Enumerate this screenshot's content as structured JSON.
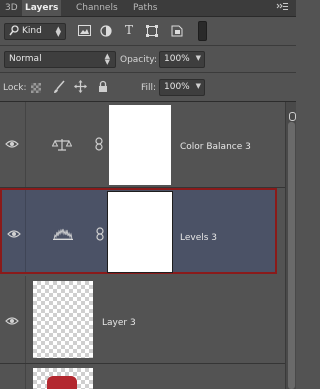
{
  "tabs": [
    {
      "label": "3D"
    },
    {
      "label": "Layers"
    },
    {
      "label": "Channels"
    },
    {
      "label": "Paths"
    }
  ],
  "filter": {
    "kind_label": "Kind"
  },
  "blend": {
    "mode": "Normal",
    "opacity_label": "Opacity:",
    "opacity_value": "100%"
  },
  "lock": {
    "label": "Lock:",
    "fill_label": "Fill:",
    "fill_value": "100%"
  },
  "layers": [
    {
      "name": "Color Balance 3",
      "icon": "scales-icon",
      "selected": false
    },
    {
      "name": "Levels 3",
      "icon": "levels-histogram-icon",
      "selected": true
    },
    {
      "name": "Layer 3",
      "icon": "",
      "selected": false
    }
  ],
  "colors": {
    "selected_bg": "#4b5266",
    "selected_border": "#8a1a1a",
    "panel_bg": "#535353"
  }
}
